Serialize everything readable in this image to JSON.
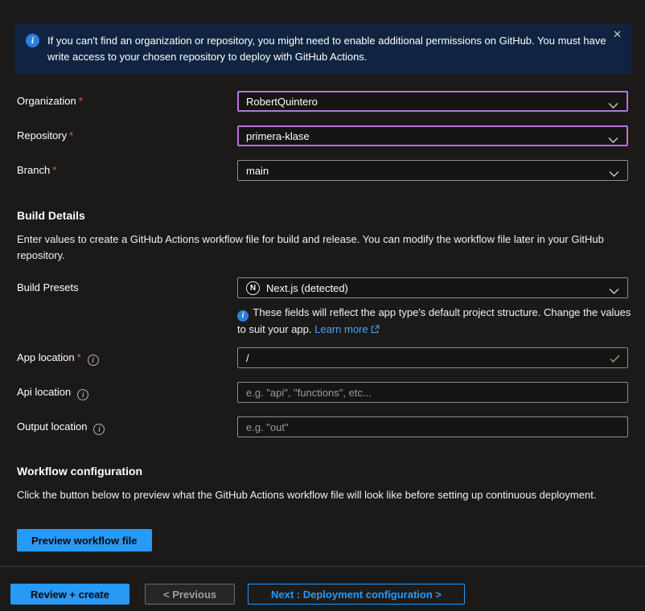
{
  "banner": {
    "text": "If you can't find an organization or repository, you might need to enable additional permissions on GitHub. You must have write access to your chosen repository to deploy with GitHub Actions.",
    "close_icon": "✕"
  },
  "form": {
    "organization": {
      "label": "Organization",
      "required": "*",
      "value": "RobertQuintero"
    },
    "repository": {
      "label": "Repository",
      "required": "*",
      "value": "primera-klase"
    },
    "branch": {
      "label": "Branch",
      "required": "*",
      "value": "main"
    },
    "build_details": {
      "heading": "Build Details",
      "description": "Enter values to create a GitHub Actions workflow file for build and release. You can modify the workflow file later in your GitHub repository."
    },
    "build_presets": {
      "label": "Build Presets",
      "value": "Next.js (detected)",
      "icon_letter": "N"
    },
    "presets_note": {
      "text": "These fields will reflect the app type's default project structure. Change the values to suit your app.",
      "link_label": "Learn more"
    },
    "app_location": {
      "label": "App location",
      "required": "*",
      "value": "/"
    },
    "api_location": {
      "label": "Api location",
      "placeholder": "e.g. \"api\", \"functions\", etc..."
    },
    "output_location": {
      "label": "Output location",
      "placeholder": "e.g. \"out\""
    }
  },
  "workflow": {
    "heading": "Workflow configuration",
    "description": "Click the button below to preview what the GitHub Actions workflow file will look like before setting up continuous deployment.",
    "preview_button": "Preview workflow file"
  },
  "footer": {
    "review_create": "Review + create",
    "previous": "< Previous",
    "next": "Next : Deployment configuration >"
  },
  "colors": {
    "accent_blue": "#2899f5",
    "modified_purple": "#b872dc",
    "link_blue": "#4ba0f5",
    "banner_bg": "#102441",
    "required_red": "#e65b5b",
    "success_green": "#7fb069"
  }
}
